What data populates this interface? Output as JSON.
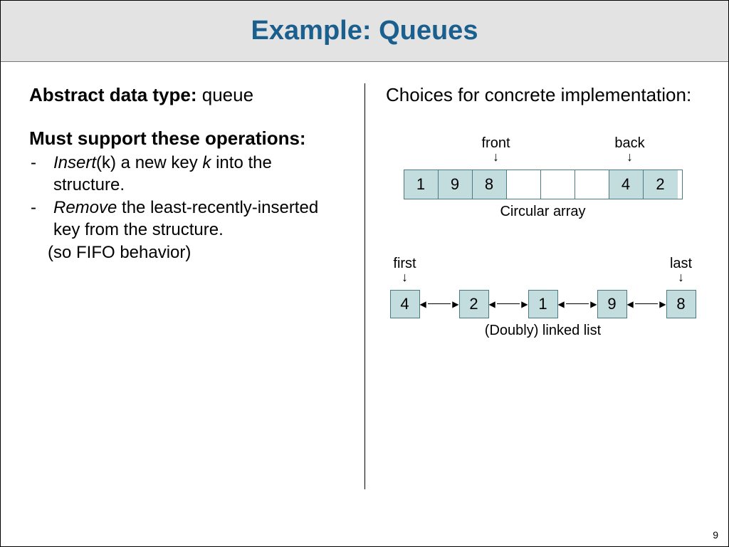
{
  "title": "Example: Queues",
  "page_number": "9",
  "left": {
    "adt_label": "Abstract data type:",
    "adt_value": "queue",
    "ops_heading": "Must support these operations:",
    "op1_word": "Insert",
    "op1_rest1": "(k) a new key ",
    "op1_k": "k",
    "op1_rest2": " into the structure.",
    "op2_word": "Remove",
    "op2_rest": " the least-recently-inserted key from the structure.",
    "op2_note": "(so FIFO behavior)"
  },
  "right": {
    "heading": "Choices for concrete implementation:",
    "circ": {
      "front_label": "front",
      "back_label": "back",
      "cells": [
        "1",
        "9",
        "8",
        "",
        "",
        "",
        "4",
        "2"
      ],
      "caption": "Circular array"
    },
    "ll": {
      "first_label": "first",
      "last_label": "last",
      "nodes": [
        "4",
        "2",
        "1",
        "9",
        "8"
      ],
      "caption": "(Doubly) linked list"
    }
  }
}
